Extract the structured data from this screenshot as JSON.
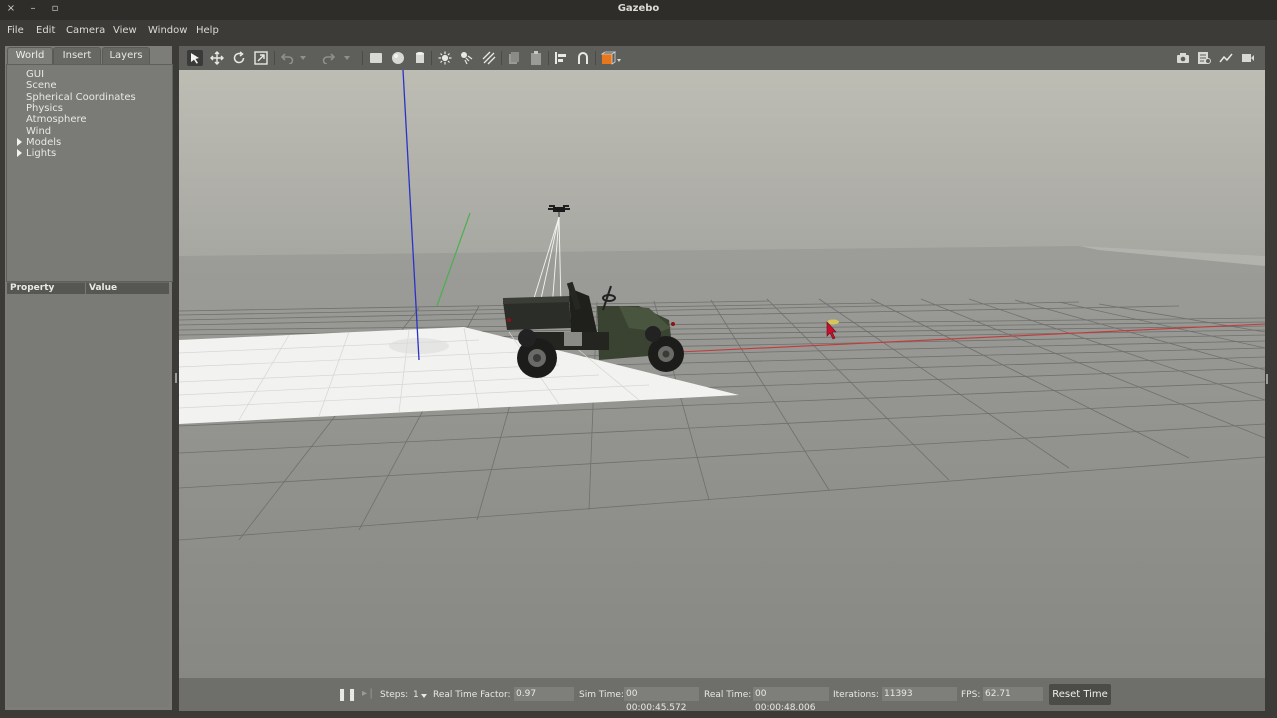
{
  "window": {
    "title": "Gazebo",
    "close": "×",
    "minimize": "–",
    "maximize": "▫"
  },
  "menu": [
    "File",
    "Edit",
    "Camera",
    "View",
    "Window",
    "Help"
  ],
  "left_tabs": [
    "World",
    "Insert",
    "Layers"
  ],
  "world_tree": {
    "items": [
      "GUI",
      "Scene",
      "Spherical Coordinates",
      "Physics",
      "Atmosphere",
      "Wind"
    ],
    "expandable": [
      "Models",
      "Lights"
    ]
  },
  "property_table": {
    "col_property": "Property",
    "col_value": "Value"
  },
  "toolbar": {
    "tools": [
      "select-arrow-icon",
      "translate-icon",
      "rotate-icon",
      "scale-icon",
      "undo-icon",
      "redo-icon",
      "box-icon",
      "sphere-icon",
      "cylinder-icon",
      "point-light-icon",
      "spot-light-icon",
      "directional-light-icon",
      "copy-icon",
      "paste-icon",
      "align-icon",
      "snap-icon",
      "view-angle-icon"
    ],
    "right_tools": [
      "screenshot-icon",
      "log-icon",
      "plot-icon",
      "video-icon"
    ]
  },
  "status": {
    "pause_symbol": "❚❚",
    "step_symbol": "▸❘",
    "steps_label": "Steps:",
    "steps_value": "1",
    "rtf_label": "Real Time Factor:",
    "rtf_value": "0.97",
    "sim_time_label": "Sim Time:",
    "sim_time_value": "00 00:00:45.572",
    "real_time_label": "Real Time:",
    "real_time_value": "00 00:00:48.006",
    "iterations_label": "Iterations:",
    "iterations_value": "11393",
    "fps_label": "FPS:",
    "fps_value": "62.71",
    "reset_label": "Reset Time"
  },
  "colors": {
    "accent_orange": "#e8761c",
    "x_axis": "#c23b3b",
    "y_axis": "#4caf50",
    "z_axis": "#2a33c8"
  }
}
